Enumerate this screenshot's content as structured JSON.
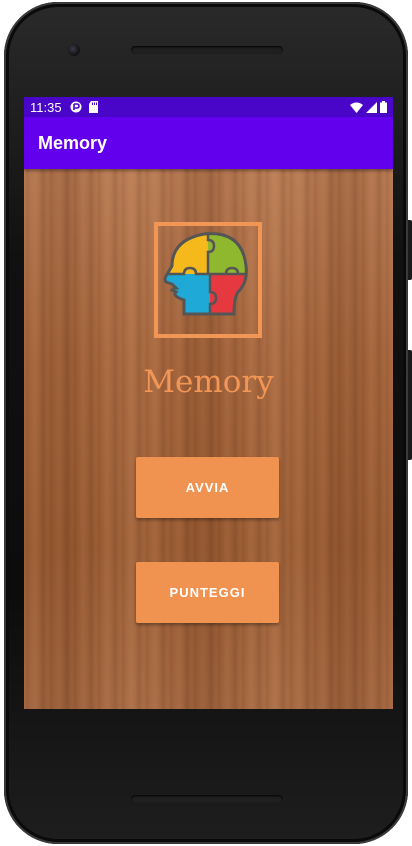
{
  "status_bar": {
    "time": "11:35",
    "icons": [
      "notification-icon",
      "sd-card-icon",
      "wifi-icon",
      "signal-icon",
      "battery-icon"
    ],
    "color": "#4a06c8"
  },
  "app_bar": {
    "title": "Memory",
    "color": "#6200ee"
  },
  "main": {
    "logo_icon": "puzzle-head-icon",
    "title": "Memory",
    "title_color": "#f29656",
    "buttons": [
      {
        "label": "AVVIA"
      },
      {
        "label": "PUNTEGGI"
      }
    ],
    "button_color": "#f19350"
  }
}
